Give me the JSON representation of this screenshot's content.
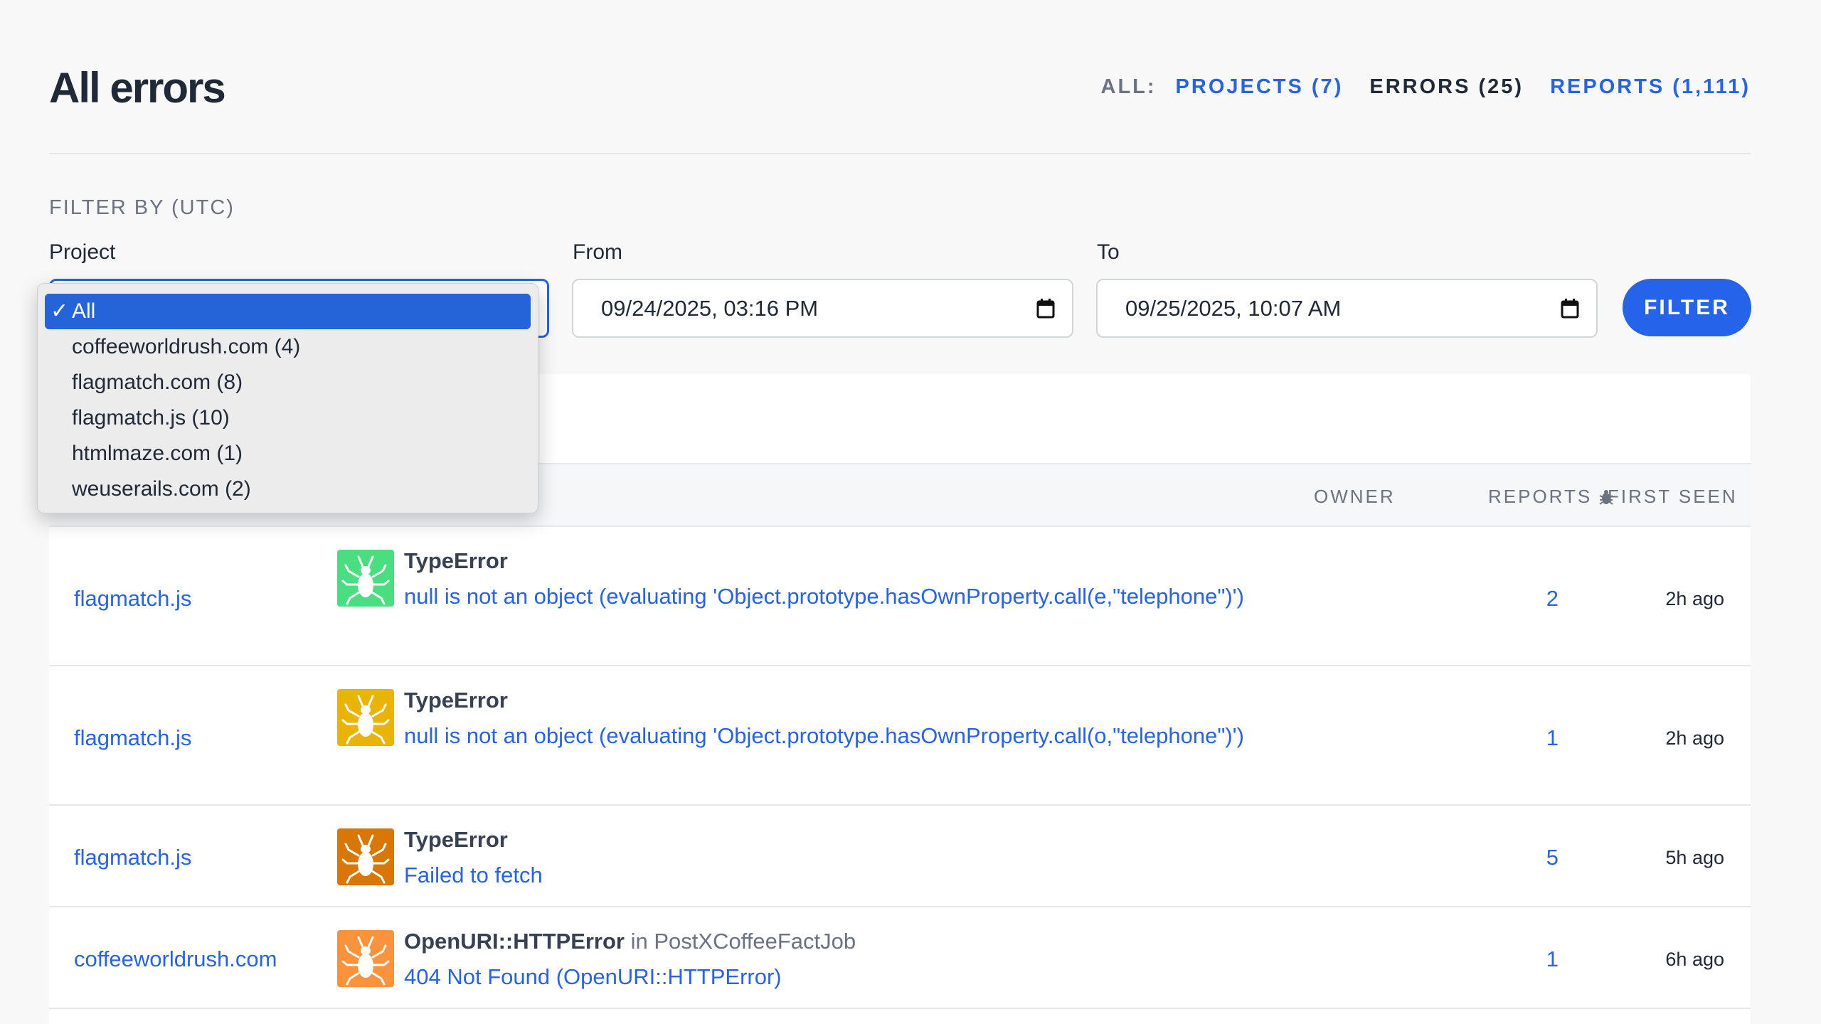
{
  "header": {
    "title": "All errors",
    "all_label": "ALL:",
    "projects": "PROJECTS (7)",
    "errors": "ERRORS (25)",
    "reports": "REPORTS (1,111)"
  },
  "filter": {
    "heading": "FILTER BY (UTC)",
    "project_label": "Project",
    "from_label": "From",
    "to_label": "To",
    "from_value": "09/24/2025, 03:16 PM",
    "to_value": "09/25/2025, 10:07 AM",
    "button": "FILTER",
    "selected_project": "All",
    "options": [
      {
        "check": "✓",
        "label": "All"
      },
      {
        "check": "",
        "label": "coffeeworldrush.com (4)"
      },
      {
        "check": "",
        "label": "flagmatch.com (8)"
      },
      {
        "check": "",
        "label": "flagmatch.js (10)"
      },
      {
        "check": "",
        "label": "htmlmaze.com (1)"
      },
      {
        "check": "",
        "label": "weuserails.com (2)"
      }
    ]
  },
  "table": {
    "headers": {
      "owner": "OWNER",
      "reports": "REPORTS",
      "first_seen": "FIRST SEEN"
    },
    "rows": [
      {
        "project": "flagmatch.js",
        "error_class": "TypeError",
        "context": "",
        "message": "null is not an object (evaluating 'Object.prototype.hasOwnProperty.call(e,\"telephone\")')",
        "reports": "2",
        "first_seen": "2h ago",
        "badge_color": "#4ade80",
        "icon": "bug-icon"
      },
      {
        "project": "flagmatch.js",
        "error_class": "TypeError",
        "context": "",
        "message": "null is not an object (evaluating 'Object.prototype.hasOwnProperty.call(o,\"telephone\")')",
        "reports": "1",
        "first_seen": "2h ago",
        "badge_color": "#eab308",
        "icon": "bug-icon"
      },
      {
        "project": "flagmatch.js",
        "error_class": "TypeError",
        "context": "",
        "message": "Failed to fetch",
        "reports": "5",
        "first_seen": "5h ago",
        "badge_color": "#d97706",
        "icon": "bug-icon"
      },
      {
        "project": "coffeeworldrush.com",
        "error_class": "OpenURI::HTTPError",
        "context": "in PostXCoffeeFactJob",
        "message": "404 Not Found (OpenURI::HTTPError)",
        "reports": "1",
        "first_seen": "6h ago",
        "badge_color": "#fb923c",
        "icon": "bug-icon"
      }
    ]
  },
  "colors": {
    "accent": "#2563eb",
    "page_bg": "#f8f8f9",
    "selected_option": "#2563d9"
  }
}
